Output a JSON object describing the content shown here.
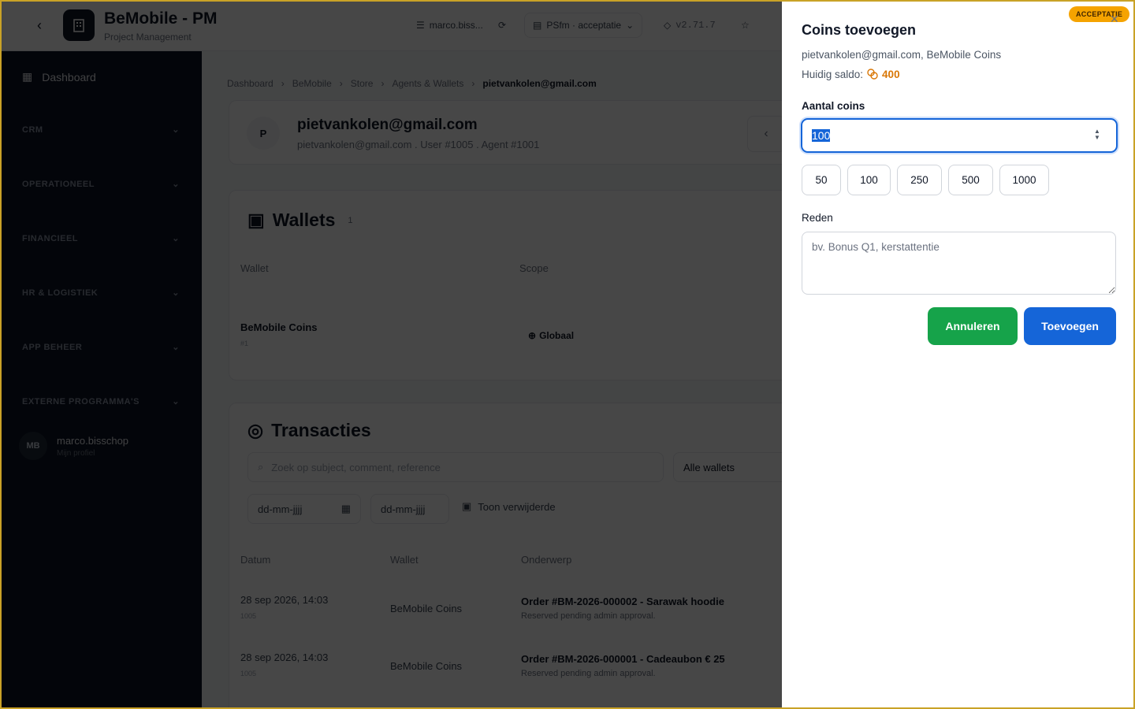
{
  "topbar": {
    "app_title": "BeMobile - PM",
    "app_subtitle": "Project Management",
    "user_chip": "marco.biss...",
    "env_chip": "PSfm · acceptatie",
    "version": "v2.71.7"
  },
  "sidebar": {
    "dashboard": "Dashboard",
    "sections": [
      "CRM",
      "OPERATIONEEL",
      "FINANCIEEL",
      "HR & LOGISTIEK",
      "APP BEHEER",
      "EXTERNE PROGRAMMA'S"
    ],
    "user": {
      "initials": "MB",
      "name": "marco.bisschop",
      "profile_link": "Mijn profiel"
    }
  },
  "breadcrumb": [
    "Dashboard",
    "BeMobile",
    "Store",
    "Agents & Wallets",
    "pietvankolen@gmail.com"
  ],
  "agent": {
    "initial": "P",
    "email": "pietvankolen@gmail.com",
    "meta": "pietvankolen@gmail.com . User #1005 . Agent #1001"
  },
  "wallets": {
    "title": "Wallets",
    "count": "1",
    "columns": {
      "wallet": "Wallet",
      "scope": "Scope"
    },
    "row": {
      "name": "BeMobile Coins",
      "id": "#1",
      "scope": "Globaal"
    }
  },
  "transactions": {
    "title": "Transacties",
    "search_placeholder": "Zoek op subject, comment, reference",
    "wallet_filter": "Alle wallets",
    "date_placeholder": "dd-mm-jjjj",
    "show_deleted": "Toon verwijderde",
    "columns": {
      "date": "Datum",
      "wallet": "Wallet",
      "subject": "Onderwerp"
    },
    "rows": [
      {
        "date": "28 sep 2026, 14:03",
        "user": "1005",
        "wallet": "BeMobile Coins",
        "subject": "Order #BM-2026-000002 - Sarawak hoodie",
        "note": "Reserved pending admin approval."
      },
      {
        "date": "28 sep 2026, 14:03",
        "user": "1005",
        "wallet": "BeMobile Coins",
        "subject": "Order #BM-2026-000001 - Cadeaubon € 25",
        "note": "Reserved pending admin approval."
      }
    ]
  },
  "panel": {
    "env_badge": "ACCEPTATIE",
    "title": "Coins toevoegen",
    "meta": "pietvankolen@gmail.com, BeMobile Coins",
    "balance_label": "Huidig saldo:",
    "balance_value": "400",
    "amount_label": "Aantal coins",
    "amount_value": "100",
    "presets": [
      "50",
      "100",
      "250",
      "500",
      "1000"
    ],
    "reason_label": "Reden",
    "reason_placeholder": "bv. Bonus Q1, kerstattentie",
    "cancel_label": "Annuleren",
    "submit_label": "Toevoegen"
  },
  "colors": {
    "accent_blue": "#1565d8",
    "cancel_green": "#16a34a",
    "balance_orange": "#d97706",
    "badge_amber": "#f5a300",
    "sidebar_bg": "#0b1424"
  }
}
